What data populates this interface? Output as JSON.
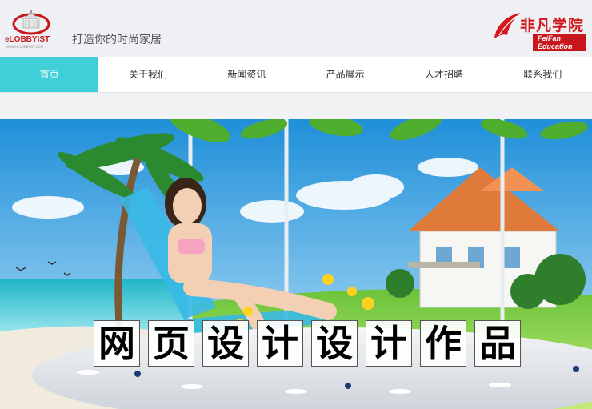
{
  "header": {
    "logo_text": "eLOBBYIST",
    "logo_sub": "WWW.E-LOBBYIST.COM",
    "slogan": "打造你的时尚家居",
    "brand_cn": "非凡学院",
    "brand_en": "FeiFan Education"
  },
  "nav": {
    "items": [
      {
        "label": "首页",
        "active": true
      },
      {
        "label": "关于我们"
      },
      {
        "label": "新闻资讯"
      },
      {
        "label": "产品展示"
      },
      {
        "label": "人才招聘"
      },
      {
        "label": "联系我们"
      }
    ]
  },
  "banner": {
    "title_chars": [
      "网",
      "页",
      "设",
      "计",
      "设",
      "计",
      "作",
      "品"
    ]
  },
  "colors": {
    "accent": "#40cfd6",
    "brand_red": "#d4171d"
  }
}
